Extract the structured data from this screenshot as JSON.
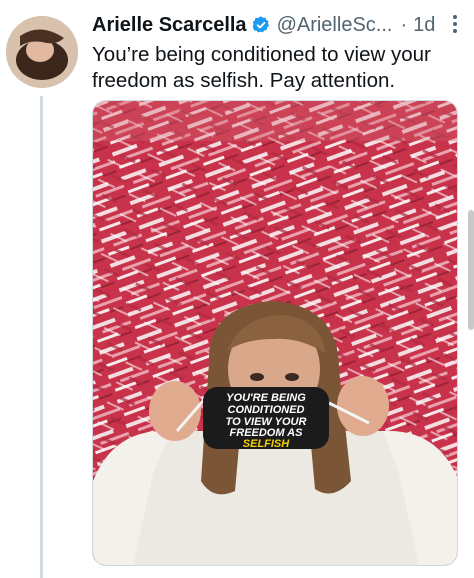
{
  "tweet": {
    "author_name": "Arielle Scarcella",
    "handle": "@ArielleSc...",
    "separator": "·",
    "time": "1d",
    "text": "You’re being conditioned to view your freedom as selfish. Pay attention."
  },
  "photo": {
    "mask_lines": [
      "YOU'RE BEING",
      "CONDITIONED",
      "TO VIEW YOUR",
      "FREEDOM AS",
      "SELFISH"
    ]
  },
  "colors": {
    "verified_blue": "#1d9bf0",
    "text_primary": "#0f1419",
    "text_secondary": "#536471",
    "thread_line": "#cfd9de"
  }
}
